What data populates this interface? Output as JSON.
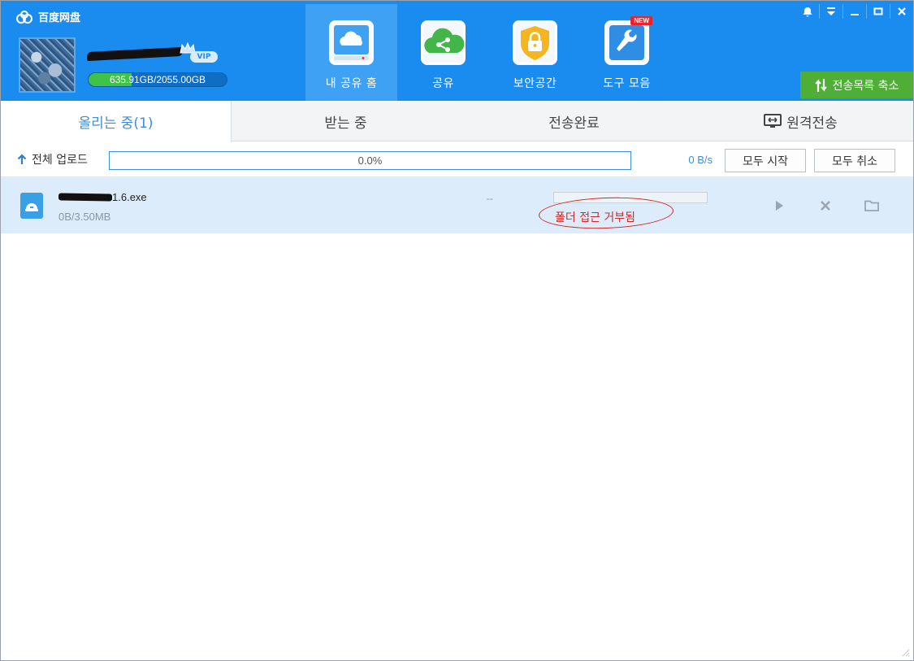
{
  "app": {
    "title": "百度网盘"
  },
  "account": {
    "vip_badge": "VIP",
    "quota_used": "635.91",
    "quota_rest": "GB/2055.00GB",
    "quota_fraction": 0.3094
  },
  "nav": [
    {
      "label": "내 공유 홈",
      "icon": "cloud-drive-icon",
      "active": true
    },
    {
      "label": "공유",
      "icon": "share-icon",
      "active": false
    },
    {
      "label": "보안공간",
      "icon": "lock-shield-icon",
      "active": false
    },
    {
      "label": "도구 모음",
      "icon": "wrench-icon",
      "active": false,
      "badge": "NEW"
    }
  ],
  "window_controls": [
    "bell-icon",
    "dropdown-icon",
    "minimize-icon",
    "maximize-icon",
    "close-icon"
  ],
  "collapse_label": "전송목록 축소",
  "tabs": [
    {
      "label": "올리는 중(1)",
      "active": true
    },
    {
      "label": "받는 중",
      "active": false
    },
    {
      "label": "전송완료",
      "active": false
    },
    {
      "label": "원격전송",
      "active": false,
      "icon": "remote-transfer-icon"
    }
  ],
  "toolbar": {
    "upload_all_label": "전체 업로드",
    "overall_progress_text": "0.0%",
    "overall_progress": 0.0,
    "speed": "0 B/s",
    "start_all_label": "모두 시작",
    "cancel_all_label": "모두 취소"
  },
  "uploads": [
    {
      "name_suffix": "1.6",
      "name_ext": ".exe",
      "size": "0B/3.50MB",
      "speed": "--",
      "progress": 0.0,
      "error": "폴더 접근 거부됨"
    }
  ],
  "colors": {
    "header_bg": "#1a8cf0",
    "nav_active": "#3fa1f4",
    "quota_fill": "#3ec247",
    "collapse_bg": "#4fae35",
    "row_bg": "#dcecfa",
    "error": "#d12a2a"
  }
}
